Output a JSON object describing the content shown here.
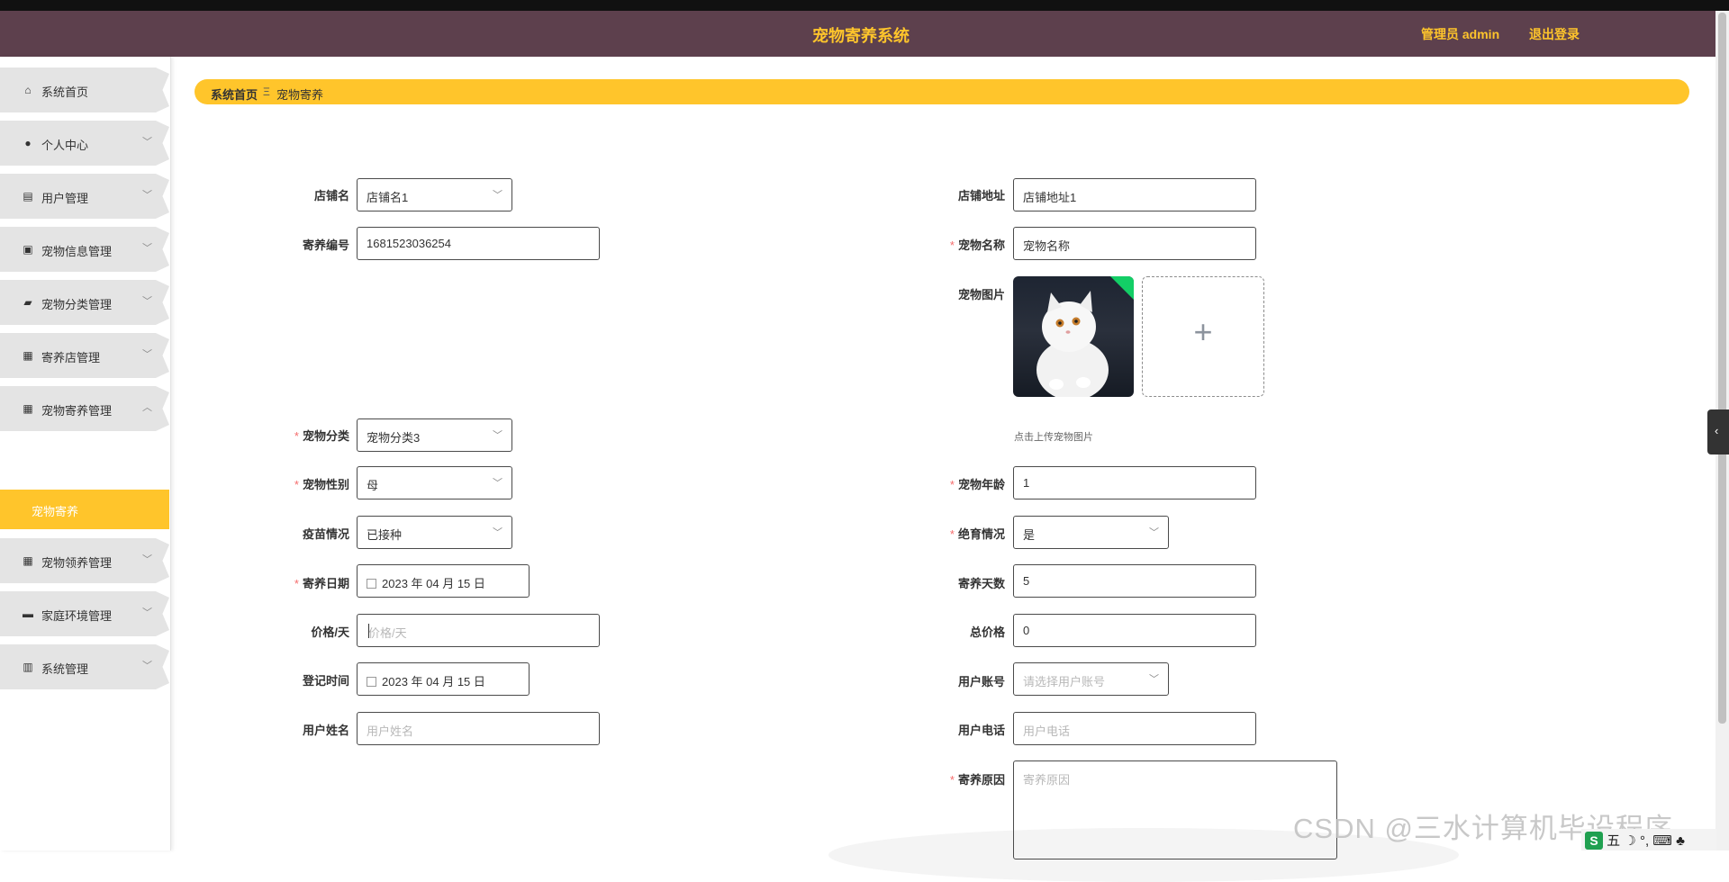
{
  "header": {
    "title": "宠物寄养系统",
    "admin": "管理员 admin",
    "logout": "退出登录"
  },
  "sidebar": {
    "items": [
      {
        "label": "系统首页",
        "icon": "home-icon",
        "glyph": "⌂",
        "chevron": ""
      },
      {
        "label": "个人中心",
        "icon": "user-icon",
        "glyph": "●",
        "chevron": "﹀"
      },
      {
        "label": "用户管理",
        "icon": "clipboard-icon",
        "glyph": "▤",
        "chevron": "﹀"
      },
      {
        "label": "宠物信息管理",
        "icon": "doc-x-icon",
        "glyph": "▣",
        "chevron": "﹀"
      },
      {
        "label": "宠物分类管理",
        "icon": "folder-icon",
        "glyph": "▰",
        "chevron": "﹀"
      },
      {
        "label": "寄养店管理",
        "icon": "grid-icon",
        "glyph": "▦",
        "chevron": "﹀"
      },
      {
        "label": "宠物寄养管理",
        "icon": "grid-icon",
        "glyph": "▦",
        "chevron": "︿"
      },
      {
        "label": "宠物领养管理",
        "icon": "grid-icon",
        "glyph": "▦",
        "chevron": "﹀"
      },
      {
        "label": "家庭环境管理",
        "icon": "briefcase-icon",
        "glyph": "▬",
        "chevron": "﹀"
      },
      {
        "label": "系统管理",
        "icon": "books-icon",
        "glyph": "▥",
        "chevron": "﹀"
      }
    ],
    "active_sub": "宠物寄养"
  },
  "breadcrumb": {
    "home": "系统首页",
    "sep": "Ξ",
    "current": "宠物寄养"
  },
  "form": {
    "shop_name": {
      "label": "店铺名",
      "value": "店铺名1"
    },
    "shop_address": {
      "label": "店铺地址",
      "value": "店铺地址1"
    },
    "foster_no": {
      "label": "寄养编号",
      "value": "1681523036254"
    },
    "pet_name": {
      "label": "宠物名称",
      "value": "宠物名称"
    },
    "pet_image": {
      "label": "宠物图片",
      "tip": "点击上传宠物图片",
      "add": "+"
    },
    "pet_category": {
      "label": "宠物分类",
      "value": "宠物分类3"
    },
    "pet_gender": {
      "label": "宠物性别",
      "value": "母"
    },
    "pet_age": {
      "label": "宠物年龄",
      "value": "1"
    },
    "vaccine": {
      "label": "疫苗情况",
      "value": "已接种"
    },
    "sterilized": {
      "label": "绝育情况",
      "value": "是"
    },
    "foster_date": {
      "label": "寄养日期",
      "value": "2023 年 04 月 15 日"
    },
    "foster_days": {
      "label": "寄养天数",
      "value": "5"
    },
    "price_per_day": {
      "label": "价格/天",
      "placeholder": "价格/天"
    },
    "total_price": {
      "label": "总价格",
      "value": "0"
    },
    "register_time": {
      "label": "登记时间",
      "value": "2023 年 04 月 15 日"
    },
    "user_account": {
      "label": "用户账号",
      "placeholder": "请选择用户账号"
    },
    "user_name": {
      "label": "用户姓名",
      "placeholder": "用户姓名"
    },
    "user_phone": {
      "label": "用户电话",
      "placeholder": "用户电话"
    },
    "foster_reason": {
      "label": "寄养原因",
      "placeholder": "寄养原因"
    }
  },
  "overlay": {
    "watermark": "CSDN @三水计算机毕设程序",
    "ime": "五 ☽ °, ⌨ ♣"
  },
  "colors": {
    "header_bg": "#5d404d",
    "accent": "#ffc52b",
    "menu_bg": "#e4e4e4",
    "required": "#f56c6c"
  }
}
